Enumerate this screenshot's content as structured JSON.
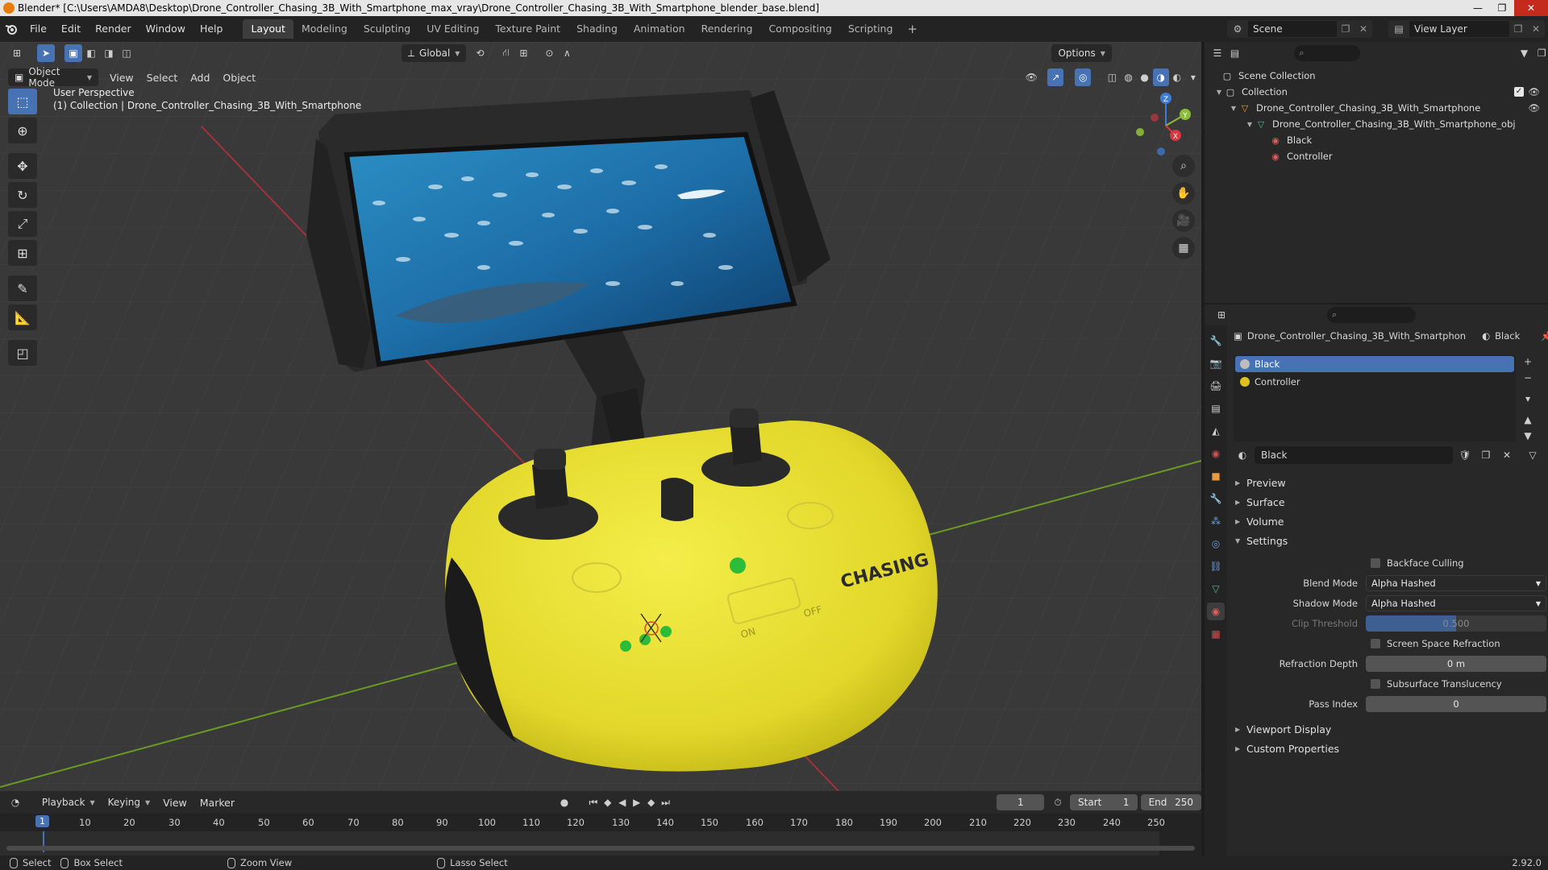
{
  "titlebar": {
    "text": "Blender* [C:\\Users\\AMDA8\\Desktop\\Drone_Controller_Chasing_3B_With_Smartphone_max_vray\\Drone_Controller_Chasing_3B_With_Smartphone_blender_base.blend]",
    "minimize": "—",
    "maximize": "❐",
    "close": "✕"
  },
  "menubar": {
    "items": [
      "File",
      "Edit",
      "Render",
      "Window",
      "Help"
    ],
    "workspaces": [
      "Layout",
      "Modeling",
      "Sculpting",
      "UV Editing",
      "Texture Paint",
      "Shading",
      "Animation",
      "Rendering",
      "Compositing",
      "Scripting"
    ],
    "active_workspace": "Layout",
    "add_workspace": "+",
    "scene": "Scene",
    "view_layer": "View Layer"
  },
  "viewport": {
    "transform_orientation": "Global",
    "options_label": "Options",
    "mode": "Object Mode",
    "menus": [
      "View",
      "Select",
      "Add",
      "Object"
    ],
    "overlay_line1": "User Perspective",
    "overlay_line2": "(1) Collection | Drone_Controller_Chasing_3B_With_Smartphone",
    "model_brand": "CHASING",
    "switch_on": "ON",
    "switch_off": "OFF",
    "gizmo": {
      "z": "Z",
      "y": "Y",
      "x": "X"
    }
  },
  "timeline": {
    "menus": [
      "Playback",
      "Keying",
      "View",
      "Marker"
    ],
    "current_frame": "1",
    "start_label": "Start",
    "start": "1",
    "end_label": "End",
    "end": "250",
    "ticks": [
      "10",
      "20",
      "30",
      "40",
      "50",
      "60",
      "70",
      "80",
      "90",
      "100",
      "110",
      "120",
      "130",
      "140",
      "150",
      "160",
      "170",
      "180",
      "190",
      "200",
      "210",
      "220",
      "230",
      "240",
      "250"
    ],
    "cursor_label": "1"
  },
  "statusbar": {
    "select": "Select",
    "box_select": "Box Select",
    "zoom_view": "Zoom View",
    "lasso_select": "Lasso Select",
    "version": "2.92.0"
  },
  "outliner": {
    "rows": [
      {
        "label": "Scene Collection"
      },
      {
        "label": "Collection"
      },
      {
        "label": "Drone_Controller_Chasing_3B_With_Smartphone"
      },
      {
        "label": "Drone_Controller_Chasing_3B_With_Smartphone_obj"
      },
      {
        "label": "Black"
      },
      {
        "label": "Controller"
      }
    ]
  },
  "properties": {
    "object_name": "Drone_Controller_Chasing_3B_With_Smartphon",
    "material_crumb": "Black",
    "slots": [
      {
        "name": "Black",
        "color": "#bdbdbd"
      },
      {
        "name": "Controller",
        "color": "#e0c31a"
      }
    ],
    "material_name": "Black",
    "panels": {
      "preview": "Preview",
      "surface": "Surface",
      "volume": "Volume",
      "settings": "Settings",
      "viewport_display": "Viewport Display",
      "custom_properties": "Custom Properties"
    },
    "settings": {
      "backface_culling": "Backface Culling",
      "blend_mode_label": "Blend Mode",
      "blend_mode": "Alpha Hashed",
      "shadow_mode_label": "Shadow Mode",
      "shadow_mode": "Alpha Hashed",
      "clip_threshold_label": "Clip Threshold",
      "clip_threshold": "0.500",
      "screen_space_refraction": "Screen Space Refraction",
      "refraction_depth_label": "Refraction Depth",
      "refraction_depth": "0 m",
      "subsurface_translucency": "Subsurface Translucency",
      "pass_index_label": "Pass Index",
      "pass_index": "0"
    }
  },
  "colors": {
    "accent": "#4772b3",
    "controller_yellow": "#e9e12f",
    "grid_x_axis": "#a3313a",
    "grid_y_axis": "#6a9a24"
  }
}
